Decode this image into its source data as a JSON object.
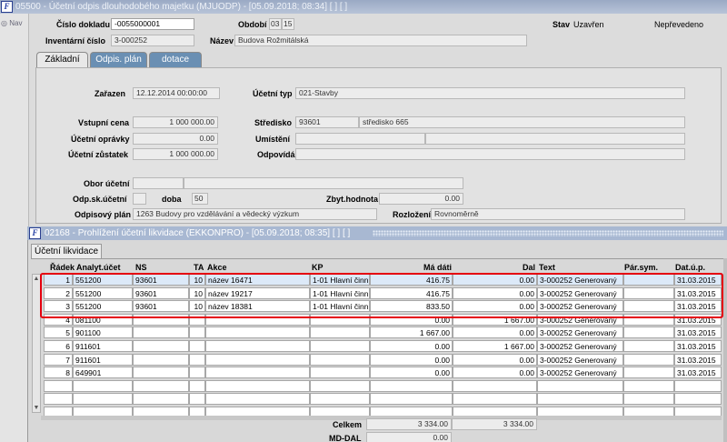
{
  "window": {
    "title": "05500 - Účetní odpis dlouhodobého majetku (MJUODP) - [05.09.2018; 08:34] [ ] [ ]",
    "logo": "F"
  },
  "sidebar": {
    "nav_label": "Nav"
  },
  "header": {
    "cislo_dokladu_label": "Číslo dokladu",
    "cislo_dokladu_value": "-0055000001",
    "obdobi_label": "Období",
    "obdobi_year": "03",
    "obdobi_month": "15",
    "stav_label": "Stav",
    "stav_value": "Uzavřen",
    "neprevedeno": "Nepřevedeno",
    "inventarni_cislo_label": "Inventární číslo",
    "inventarni_cislo_value": "3-000252",
    "nazev_label": "Název",
    "nazev_value": "Budova Rožmitálská"
  },
  "tabs": [
    {
      "label": "Základní",
      "active": true
    },
    {
      "label": "Odpis. plán",
      "active": false
    },
    {
      "label": "dotace",
      "active": false
    }
  ],
  "form": {
    "zarazen_label": "Zařazen",
    "zarazen_value": "12.12.2014 00:00:00",
    "ucetni_typ_label": "Účetní typ",
    "ucetni_typ_value": "021-Stavby",
    "vstupni_cena_label": "Vstupní cena",
    "vstupni_cena_value": "1 000 000.00",
    "stredisko_label": "Středisko",
    "stredisko_code": "93601",
    "stredisko_name": "středisko 665",
    "ucetni_opravky_label": "Účetní oprávky",
    "ucetni_opravky_value": "0.00",
    "umisteni_label": "Umístění",
    "umisteni_value": "",
    "ucetni_zustatek_label": "Účetní zůstatek",
    "ucetni_zustatek_value": "1 000 000.00",
    "odpovida_label": "Odpovídá",
    "odpovida_value": "",
    "obor_ucetni_label": "Obor účetní",
    "odp_sk_ucetni_label": "Odp.sk.účetní",
    "doba_label": "doba",
    "doba_value": "50",
    "zbyt_hodnota_label": "Zbyt.hodnota",
    "zbyt_hodnota_value": "0.00",
    "odpisovy_plan_label": "Odpisový plán",
    "odpisovy_plan_value": "1263 Budovy pro vzdělávání a vědecký výzkum",
    "rozlozeni_label": "Rozložení",
    "rozlozeni_value": "Rovnoměrně"
  },
  "subwindow": {
    "title": "02168 - Prohlížení účetní likvidace (EKKONPRO) - [05.09.2018; 08:35] [ ] [ ]",
    "logo": "F",
    "tab": "Účetní likvidace",
    "columns": [
      "Řádek",
      "Analyt.účet",
      "NS",
      "TA",
      "Akce",
      "KP",
      "Má dáti",
      "Dal",
      "Text",
      "Pár.sym.",
      "Dat.ú.p."
    ],
    "rows": [
      {
        "radek": "1",
        "ucet": "551200",
        "ns": "93601",
        "ta": "10",
        "akce": "název 16471",
        "kp": "1-01 Hlavní činn",
        "ma_dati": "416.75",
        "dal": "0.00",
        "text": "3-000252 Generovaný",
        "par": "",
        "dat": "31.03.2015"
      },
      {
        "radek": "2",
        "ucet": "551200",
        "ns": "93601",
        "ta": "10",
        "akce": "název 19217",
        "kp": "1-01 Hlavní činn",
        "ma_dati": "416.75",
        "dal": "0.00",
        "text": "3-000252 Generovaný",
        "par": "",
        "dat": "31.03.2015"
      },
      {
        "radek": "3",
        "ucet": "551200",
        "ns": "93601",
        "ta": "10",
        "akce": "název 18381",
        "kp": "1-01 Hlavní činn",
        "ma_dati": "833.50",
        "dal": "0.00",
        "text": "3-000252 Generovaný",
        "par": "",
        "dat": "31.03.2015"
      },
      {
        "radek": "4",
        "ucet": "081100",
        "ns": "",
        "ta": "",
        "akce": "",
        "kp": "",
        "ma_dati": "0.00",
        "dal": "1 667.00",
        "text": "3-000252 Generovaný",
        "par": "",
        "dat": "31.03.2015"
      },
      {
        "radek": "5",
        "ucet": "901100",
        "ns": "",
        "ta": "",
        "akce": "",
        "kp": "",
        "ma_dati": "1 667.00",
        "dal": "0.00",
        "text": "3-000252 Generovaný",
        "par": "",
        "dat": "31.03.2015"
      },
      {
        "radek": "6",
        "ucet": "911601",
        "ns": "",
        "ta": "",
        "akce": "",
        "kp": "",
        "ma_dati": "0.00",
        "dal": "1 667.00",
        "text": "3-000252 Generovaný",
        "par": "",
        "dat": "31.03.2015"
      },
      {
        "radek": "7",
        "ucet": "911601",
        "ns": "",
        "ta": "",
        "akce": "",
        "kp": "",
        "ma_dati": "0.00",
        "dal": "0.00",
        "text": "3-000252 Generovaný",
        "par": "",
        "dat": "31.03.2015"
      },
      {
        "radek": "8",
        "ucet": "649901",
        "ns": "",
        "ta": "",
        "akce": "",
        "kp": "",
        "ma_dati": "0.00",
        "dal": "0.00",
        "text": "3-000252 Generovaný",
        "par": "",
        "dat": "31.03.2015"
      }
    ],
    "celkem_label": "Celkem",
    "celkem_ma_dati": "3 334.00",
    "celkem_dal": "3 334.00",
    "md_dal_label": "MD-DAL",
    "md_dal_value": "0.00"
  },
  "colors": {
    "highlight": "#e5000f",
    "tab_inactive": "#6a8fb3",
    "titlebar": "#9aa9c4"
  }
}
